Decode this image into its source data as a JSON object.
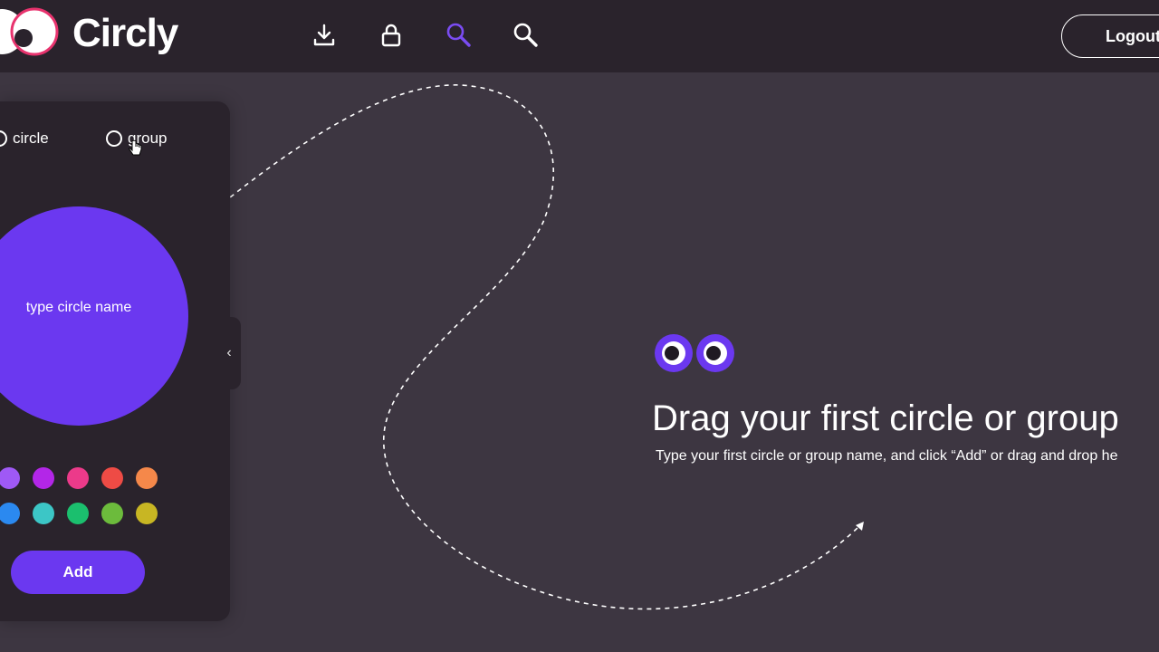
{
  "header": {
    "brand": "Circly",
    "nav_icons": [
      "download-icon",
      "lock-icon",
      "search-purple-icon",
      "search-icon"
    ],
    "logout_label": "Logout"
  },
  "panel": {
    "type_options": [
      {
        "label": "circle",
        "selected": false
      },
      {
        "label": "group",
        "selected": false
      }
    ],
    "circle": {
      "placeholder": "type circle name",
      "color": "#6b38f0"
    },
    "swatches": [
      "#9f59f5",
      "#b326e8",
      "#ec3a8a",
      "#ee4b45",
      "#f5884a",
      "#2b89f0",
      "#3cc6c6",
      "#1bbf6e",
      "#6cbb3c",
      "#c8b623"
    ],
    "add_label": "Add",
    "collapse_icon": "chevron-left-icon"
  },
  "empty_state": {
    "title": "Drag your first circle or group",
    "subtitle": "Type your first circle or group name, and click “Add” or drag and drop he"
  },
  "colors": {
    "background": "#3d3641",
    "surface": "#2a232c",
    "accent": "#6b38f0",
    "logo_ring": "#e8336e"
  }
}
